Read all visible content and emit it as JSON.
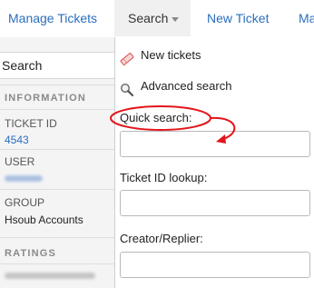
{
  "nav": {
    "manage_tickets": "Manage Tickets",
    "search": "Search",
    "new_ticket": "New Ticket",
    "more": "Ma"
  },
  "sidebar": {
    "search_label": "Search",
    "information_heading": "INFORMATION",
    "ticket_id_label": "TICKET ID",
    "ticket_id_value": "4543",
    "user_label": "USER",
    "group_label": "GROUP",
    "group_value": "Hsoub Accounts",
    "ratings_heading": "RATINGS"
  },
  "dropdown": {
    "new_tickets": "New tickets",
    "advanced_search": "Advanced search",
    "quick_search_label": "Quick search:",
    "quick_search_value": "",
    "ticket_id_lookup_label": "Ticket ID lookup:",
    "ticket_id_lookup_value": "",
    "creator_label": "Creator/Replier:",
    "creator_value": ""
  },
  "icons": {
    "new_tickets": "ticket-icon",
    "advanced_search": "magnifier-icon"
  },
  "colors": {
    "link": "#2a6ebf",
    "annotation": "#e3151a",
    "active_tab_bg": "#f0f0f0",
    "sidebar_bg": "#f4f4f4"
  }
}
